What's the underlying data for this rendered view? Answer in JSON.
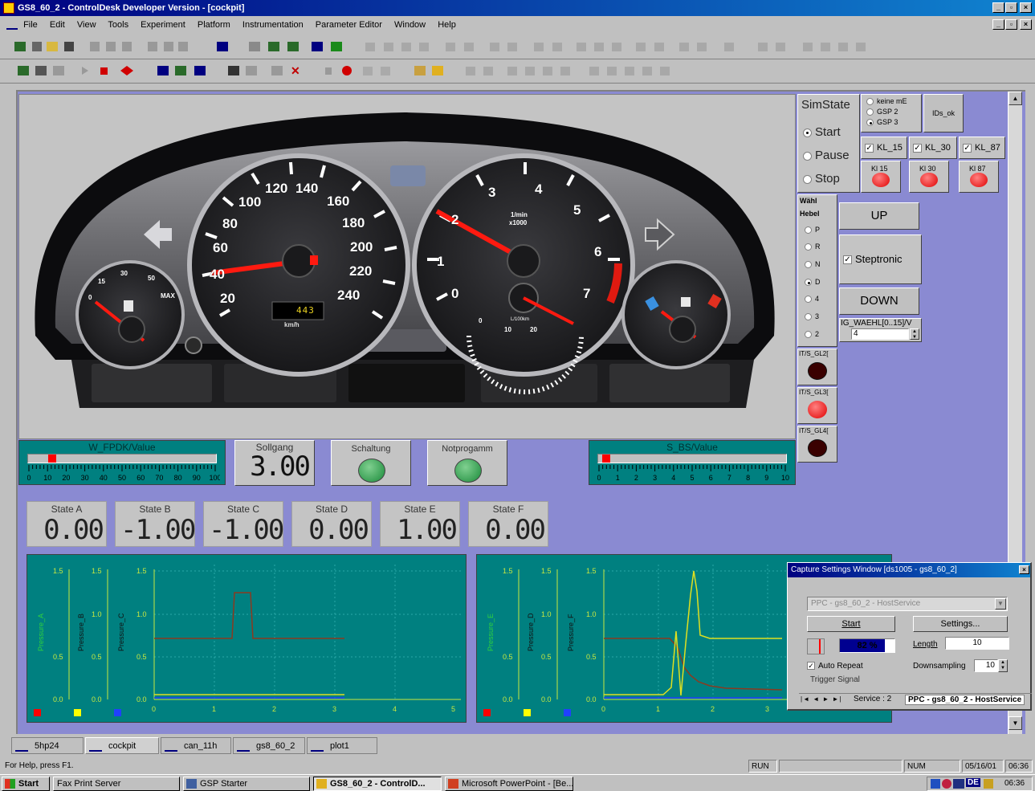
{
  "window": {
    "title": "GS8_60_2 - ControlDesk Developer Version - [cockpit]",
    "menu": [
      "File",
      "Edit",
      "View",
      "Tools",
      "Experiment",
      "Platform",
      "Instrumentation",
      "Parameter Editor",
      "Window",
      "Help"
    ]
  },
  "simstate": {
    "title": "SimState",
    "options": [
      {
        "label": "Start",
        "selected": true
      },
      {
        "label": "Pause",
        "selected": false
      },
      {
        "label": "Stop",
        "selected": false
      }
    ]
  },
  "gsp": {
    "options": [
      {
        "label": "keine mE",
        "selected": false
      },
      {
        "label": "GSP 2",
        "selected": false
      },
      {
        "label": "GSP 3",
        "selected": true
      }
    ],
    "ids_button": "IDs_ok"
  },
  "kl_checks": [
    "KL_15",
    "KL_30",
    "KL_87"
  ],
  "kl_lamps": [
    "Kl 15",
    "Kl 30",
    "Kl 87"
  ],
  "wahlhebel": {
    "title_line1": "Wähl",
    "title_line2": "Hebel",
    "options": [
      {
        "label": "P",
        "selected": false
      },
      {
        "label": "R",
        "selected": false
      },
      {
        "label": "N",
        "selected": false
      },
      {
        "label": "D",
        "selected": true
      },
      {
        "label": "4",
        "selected": false
      },
      {
        "label": "3",
        "selected": false
      },
      {
        "label": "2",
        "selected": false
      }
    ]
  },
  "controls": {
    "up_label": "UP",
    "steptronic_label": "Steptronic",
    "down_label": "DOWN",
    "waehl_label": "IG_WAEHL[0..15]/V",
    "waehl_value": "4"
  },
  "gl_lamps": [
    {
      "label": "IT/S_GL2[",
      "color": "#3a0000"
    },
    {
      "label": "IT/S_GL3[",
      "color": "#ff0000"
    },
    {
      "label": "IT/S_GL4[",
      "color": "#3a0000"
    }
  ],
  "speedo": {
    "labels": [
      "20",
      "40",
      "60",
      "80",
      "100",
      "120",
      "140",
      "160",
      "180",
      "200",
      "220",
      "240"
    ],
    "digital": "443",
    "unit": "km/h"
  },
  "tacho": {
    "labels": [
      "0",
      "1",
      "2",
      "3",
      "4",
      "5",
      "6",
      "7"
    ],
    "unit_line1": "1/min",
    "unit_line2": "x1000",
    "econ_unit": "L/100km",
    "econ_labels": [
      "0",
      "10",
      "20"
    ]
  },
  "fuel": {
    "labels": [
      "0",
      "15",
      "30",
      "50",
      "MAX"
    ]
  },
  "fpdk": {
    "title": "W_FPDK/Value",
    "ticks": [
      "0",
      "10",
      "20",
      "30",
      "40",
      "50",
      "60",
      "70",
      "80",
      "90",
      "100"
    ],
    "value_fraction": 0.11
  },
  "sollgang": {
    "title": "Sollgang",
    "value": "3.00"
  },
  "schaltung": {
    "title": "Schaltung"
  },
  "notprog": {
    "title": "Notprogamm"
  },
  "sbs": {
    "title": "S_BS/Value",
    "ticks": [
      "0",
      "1",
      "2",
      "3",
      "4",
      "5",
      "6",
      "7",
      "8",
      "9",
      "10"
    ],
    "value_fraction": 0.02
  },
  "states": [
    {
      "label": "State A",
      "value": "0.00"
    },
    {
      "label": "State B",
      "value": "-1.00"
    },
    {
      "label": "State C",
      "value": "-1.00"
    },
    {
      "label": "State D",
      "value": "0.00"
    },
    {
      "label": "State E",
      "value": "1.00"
    },
    {
      "label": "State F",
      "value": "0.00"
    }
  ],
  "plot_left": {
    "ylabels": [
      "Pressure_A",
      "Pressure_B",
      "Pressure_C"
    ],
    "yticks": [
      "0.0",
      "0.5",
      "1.0",
      "1.5"
    ],
    "xticks": [
      "0",
      "1",
      "2",
      "3",
      "4",
      "5"
    ]
  },
  "plot_right": {
    "ylabels": [
      "Pressure_E",
      "Pressure_D",
      "Pressure_F"
    ],
    "yticks": [
      "0.0",
      "0.5",
      "1.0",
      "1.5"
    ],
    "xticks": [
      "0",
      "1",
      "2",
      "3"
    ]
  },
  "capture": {
    "title": "Capture Settings Window [ds1005 - gs8_60_2]",
    "service_select": "PPC - gs8_60_2 - HostService",
    "start_label": "Start",
    "settings_label": "Settings...",
    "progress_text": "82 %",
    "length_label": "Length",
    "length_value": "10",
    "autorepeat_label": "Auto Repeat",
    "downsampling_label": "Downsampling",
    "downsampling_value": "10",
    "trigger_label": "Trigger Signal",
    "tab_service": "Service : 2",
    "tab_ppc": "PPC - gs8_60_2 - HostService"
  },
  "tasktabs": [
    "5hp24",
    "cockpit",
    "can_11h",
    "gs8_60_2",
    "plot1"
  ],
  "status": {
    "help": "For Help, press F1.",
    "run": "RUN",
    "num": "NUM",
    "date": "05/16/01",
    "time": "06:36"
  },
  "taskbar": {
    "start": "Start",
    "items": [
      "Fax Print Server",
      "GSP Starter",
      "GS8_60_2 - ControlD...",
      "Microsoft PowerPoint - [Be..."
    ],
    "tray_lang": "DE",
    "clock": "06:36"
  },
  "colors": {
    "mdi_bg": "#8a8ad2",
    "plot_bg": "#008080",
    "lamp_red": "#ff0000",
    "lamp_green": "#1a8a3a",
    "needle": "#ff0000"
  }
}
